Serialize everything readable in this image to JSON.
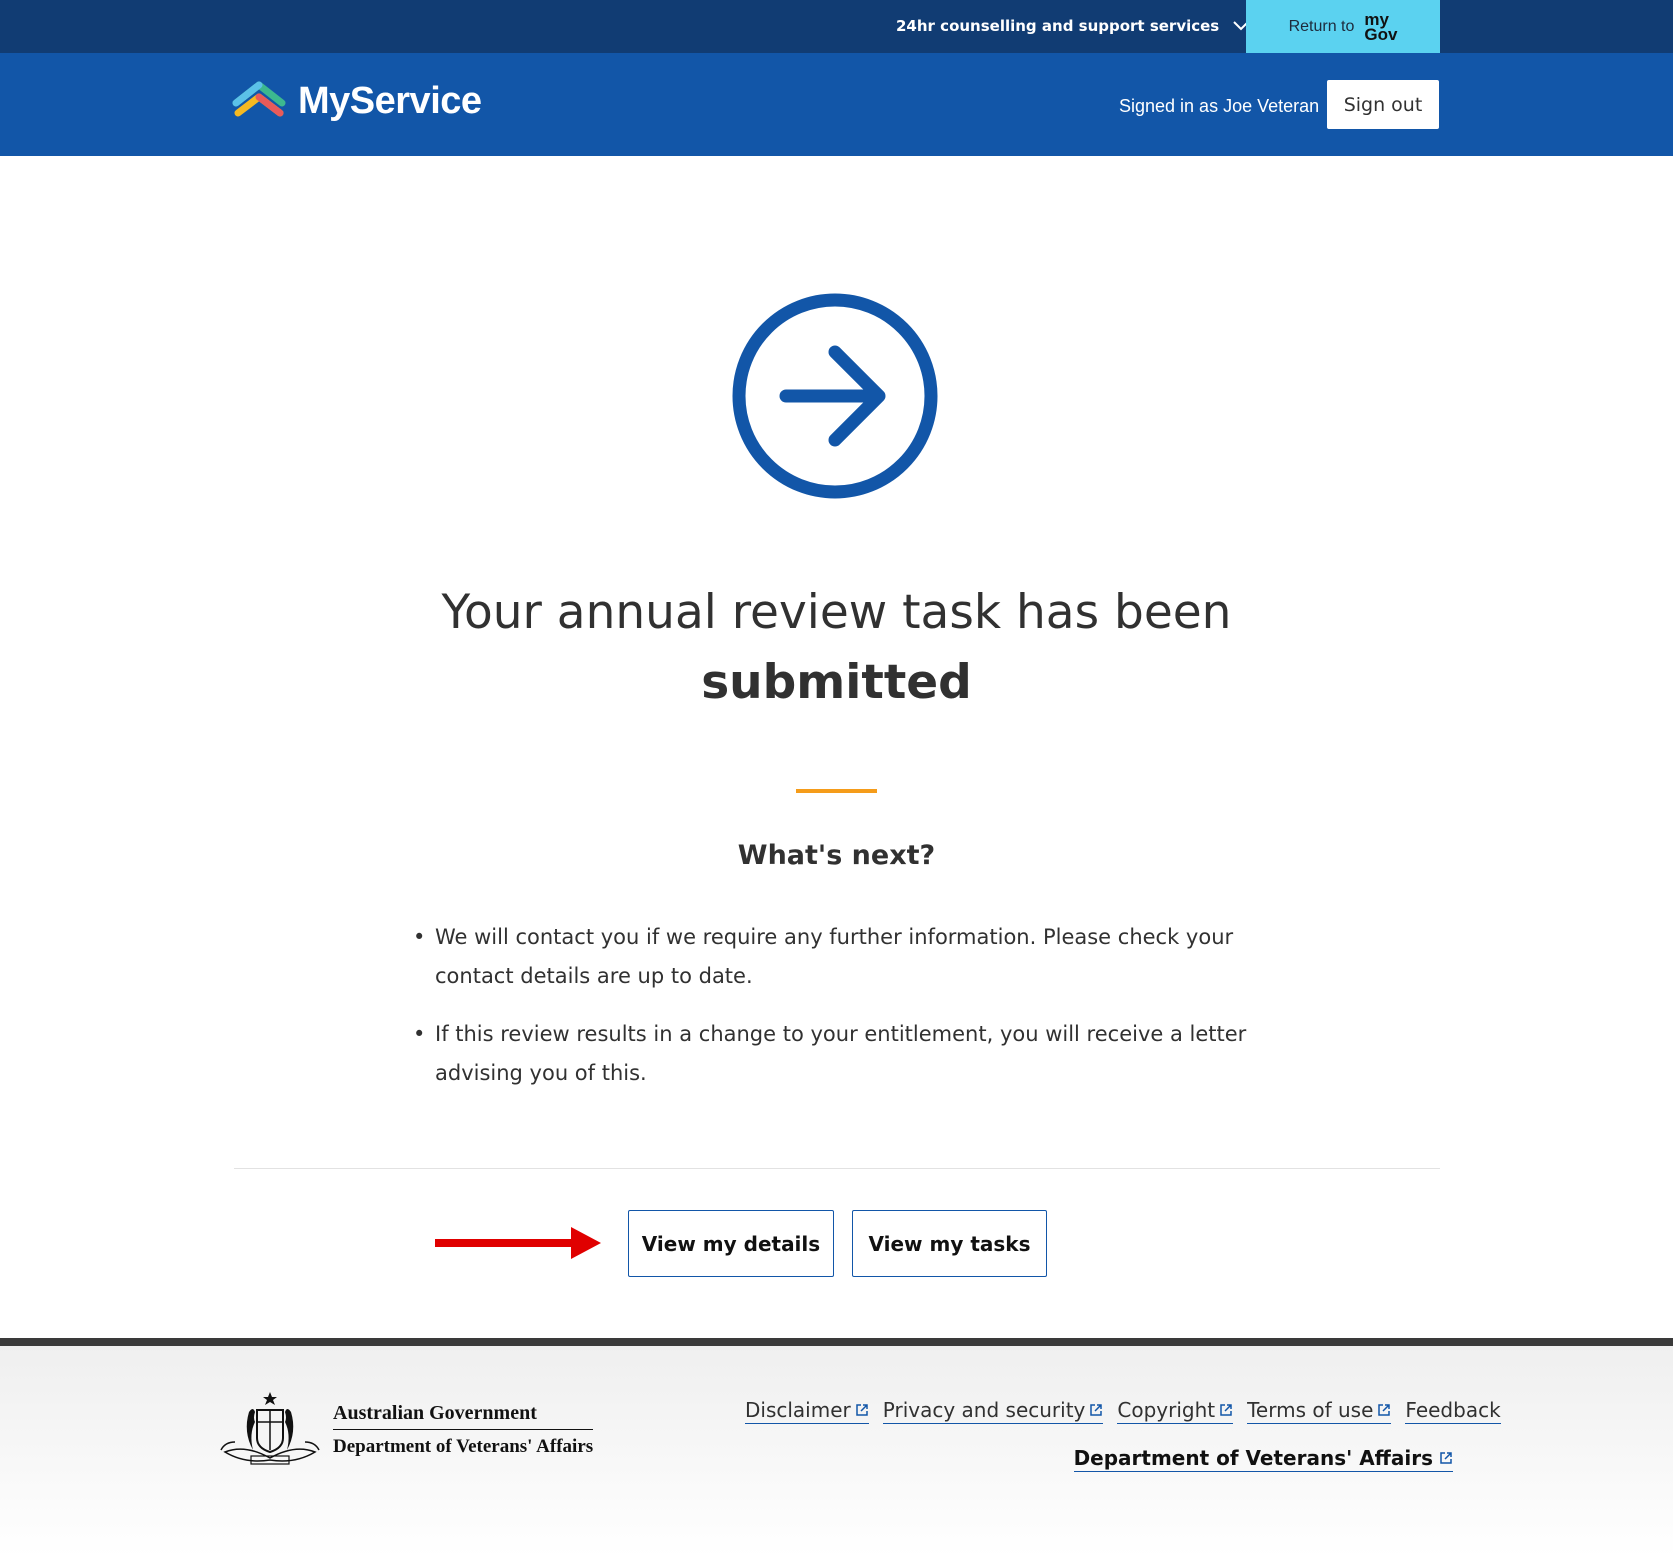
{
  "topbar": {
    "support_label": "24hr counselling and support services",
    "return_label": "Return to",
    "mygov_logo_line1": "my",
    "mygov_logo_line2": "Gov"
  },
  "header": {
    "brand_name": "MyService",
    "signed_in_text": "Signed in as Joe Veteran",
    "sign_out_label": "Sign out"
  },
  "main": {
    "icon": "arrow-right-circle-icon",
    "title_line1": "Your annual review task has been",
    "title_line2": "submitted",
    "next_heading": "What's next?",
    "next_items": [
      "We will contact you if we require any further information. Please check your contact details are up to date.",
      "If this review results in a change to your entitlement, you will receive a letter advising you of this."
    ],
    "buttons": {
      "view_details": "View my details",
      "view_tasks": "View my tasks"
    }
  },
  "footer": {
    "gov_line1": "Australian Government",
    "gov_line2": "Department of  Veterans' Affairs",
    "links": [
      "Disclaimer",
      "Privacy and security",
      "Copyright",
      "Terms of use",
      "Feedback"
    ],
    "dva_link": "Department of Veterans' Affairs"
  },
  "colors": {
    "topbar": "#113c73",
    "header": "#1256a8",
    "mygov_button": "#5bd2f0",
    "accent_orange": "#f59c1a",
    "annotation_arrow": "#e00000"
  }
}
